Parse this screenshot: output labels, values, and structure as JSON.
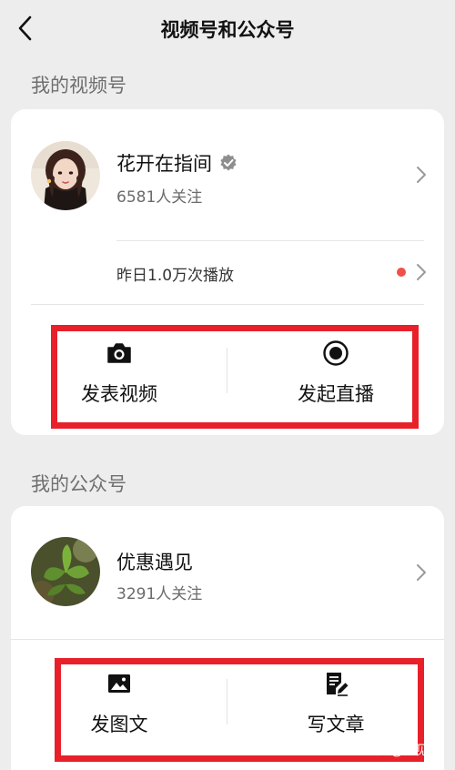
{
  "header": {
    "title": "视频号和公众号",
    "back_icon": "back-chevron-icon"
  },
  "channels": {
    "section_label": "我的视频号",
    "account_name": "花开在指间",
    "followers": "6581人关注",
    "stats": "昨日1.0万次播放",
    "actions": [
      {
        "label": "发表视频",
        "icon": "camera-icon"
      },
      {
        "label": "发起直播",
        "icon": "live-record-icon"
      }
    ]
  },
  "official": {
    "section_label": "我的公众号",
    "account_name": "优惠遇见",
    "followers": "3291人关注",
    "actions": [
      {
        "label": "发图文",
        "icon": "image-icon"
      },
      {
        "label": "写文章",
        "icon": "edit-note-icon"
      }
    ]
  },
  "watermark": "知乎 @遇见yh",
  "colors": {
    "highlight": "#e8202a",
    "dot": "#f0504a",
    "background": "#ededed"
  }
}
